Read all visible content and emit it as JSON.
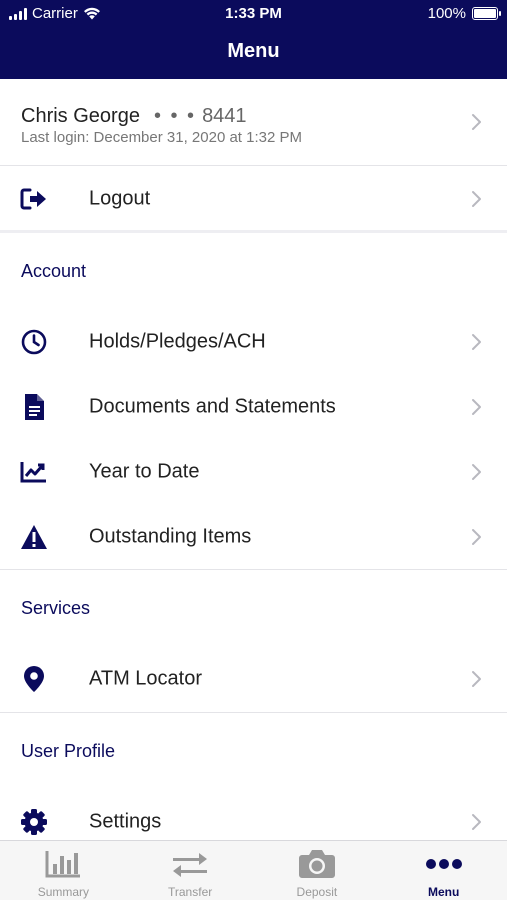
{
  "status_bar": {
    "carrier": "Carrier",
    "time": "1:33 PM",
    "battery": "100%"
  },
  "header": {
    "title": "Menu"
  },
  "user": {
    "name": "Chris George",
    "masked": "• • •",
    "account_suffix": "8441",
    "last_login": "Last login: December 31, 2020 at 1:32 PM"
  },
  "logout": {
    "label": "Logout",
    "icon": "logout-icon"
  },
  "sections": {
    "account": {
      "title": "Account",
      "items": [
        {
          "label": "Holds/Pledges/ACH",
          "icon": "clock-icon"
        },
        {
          "label": "Documents and Statements",
          "icon": "document-icon"
        },
        {
          "label": "Year to Date",
          "icon": "chart-line-icon"
        },
        {
          "label": "Outstanding Items",
          "icon": "warning-icon"
        }
      ]
    },
    "services": {
      "title": "Services",
      "items": [
        {
          "label": "ATM Locator",
          "icon": "map-pin-icon"
        }
      ]
    },
    "user_profile": {
      "title": "User Profile",
      "items": [
        {
          "label": "Settings",
          "icon": "gear-icon"
        }
      ]
    }
  },
  "tabbar": {
    "tabs": [
      {
        "label": "Summary",
        "icon": "bar-chart-icon"
      },
      {
        "label": "Transfer",
        "icon": "transfer-arrows-icon"
      },
      {
        "label": "Deposit",
        "icon": "camera-icon"
      },
      {
        "label": "Menu",
        "icon": "more-dots-icon"
      }
    ],
    "active": "Menu"
  },
  "colors": {
    "brand_navy": "#0b0b5c",
    "tab_inactive": "#999999",
    "divider": "#e4e4e8"
  }
}
